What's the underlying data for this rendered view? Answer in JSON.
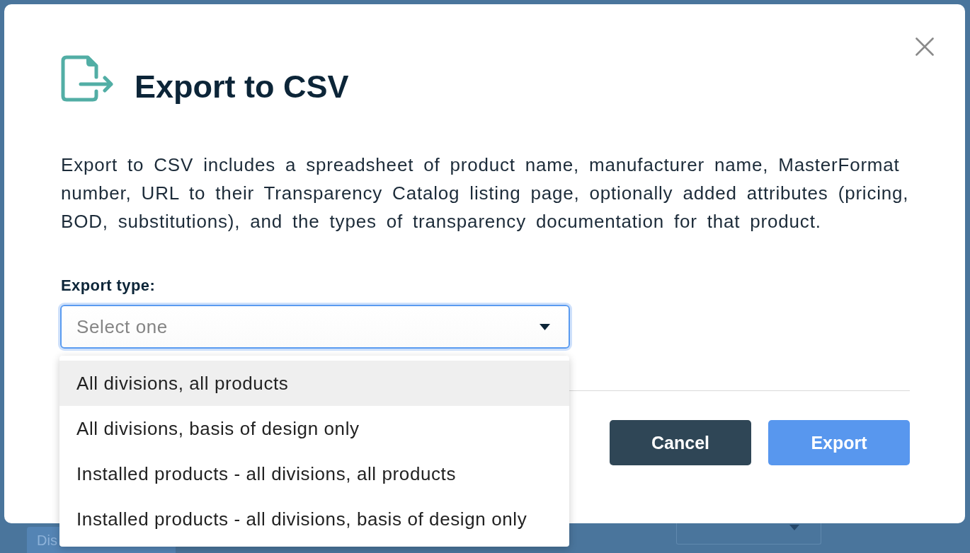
{
  "dialog": {
    "title": "Export to CSV",
    "description": "Export to CSV includes a spreadsheet of product name, manufacturer name, MasterFormat number, URL to their Transparency Catalog listing page, optionally added attributes (pricing, BOD, substitutions), and the types of transparency documentation for that product.",
    "field_label": "Export type:",
    "select": {
      "placeholder": "Select one",
      "expanded": true,
      "focused": true
    },
    "options": [
      {
        "label": "All divisions, all products",
        "highlighted": true
      },
      {
        "label": "All divisions, basis of design only",
        "highlighted": false
      },
      {
        "label": "Installed products - all divisions, all products",
        "highlighted": false
      },
      {
        "label": "Installed products - all divisions, basis of design only",
        "highlighted": false
      }
    ],
    "buttons": [
      {
        "label": "Cancel",
        "kind": "secondary"
      },
      {
        "label": "Export",
        "kind": "primary"
      }
    ]
  },
  "background": {
    "button_label": "Dis"
  }
}
